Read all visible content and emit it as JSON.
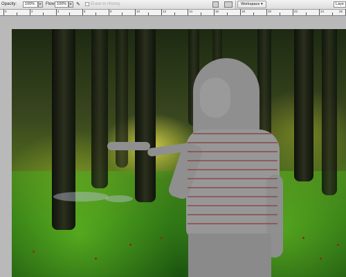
{
  "options_bar": {
    "opacity_label": "Opacity:",
    "opacity_value": "100%",
    "flow_label": "Flow:",
    "flow_value": "100%",
    "erase_to_history_label": "Erase to History",
    "workspace_label": "Workspace",
    "right_field_text": "Laye"
  },
  "ruler": {
    "labels": [
      "0",
      "2",
      "4",
      "6",
      "8",
      "10",
      "12",
      "14",
      "16",
      "18",
      "20",
      "22",
      "24",
      "26"
    ]
  }
}
